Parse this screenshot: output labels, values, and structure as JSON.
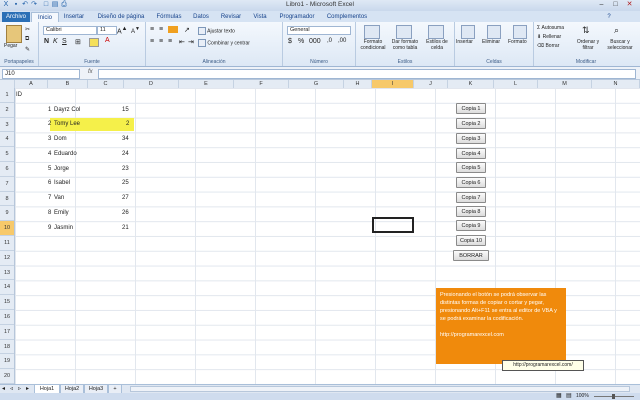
{
  "window": {
    "title": "Libro1 - Microsoft Excel"
  },
  "ribbon_tabs": [
    "Archivo",
    "Inicio",
    "Insertar",
    "Diseño de página",
    "Fórmulas",
    "Datos",
    "Revisar",
    "Vista",
    "Programador",
    "Complementos"
  ],
  "ribbon": {
    "paste_label": "Pegar",
    "font_name": "Calibri",
    "font_size": "11",
    "wrap_label": "Ajustar texto",
    "merge_label": "Combinar y centrar",
    "number_format": "General",
    "cond_format_label": "Formato condicional",
    "table_format_label": "Dar formato como tabla",
    "cell_styles_label": "Estilos de celda",
    "insert_label": "Insertar",
    "delete_label": "Eliminar",
    "format_label": "Formato",
    "autosum_label": "Autosuma",
    "fill_label": "Rellenar",
    "clear_label": "Borrar",
    "sort_label": "Ordenar y filtrar",
    "find_label": "Buscar y seleccionar",
    "groups": [
      "Portapapeles",
      "Fuente",
      "Alineación",
      "Número",
      "Estilos",
      "Celdas",
      "Modificar"
    ]
  },
  "formula_bar": {
    "name_box": "J10",
    "fx": "fx",
    "formula": ""
  },
  "columns": [
    "A",
    "B",
    "C",
    "D",
    "E",
    "F",
    "G",
    "H",
    "I",
    "J",
    "K",
    "L",
    "M",
    "N"
  ],
  "active_column": "J",
  "rows": [
    "1",
    "2",
    "3",
    "4",
    "5",
    "6",
    "7",
    "8",
    "9",
    "10",
    "11",
    "12",
    "13",
    "14",
    "15",
    "16",
    "17",
    "18",
    "19",
    "20"
  ],
  "active_row": "10",
  "cell_a1": "ID",
  "people": [
    {
      "id": "1",
      "name": "Dayrz Col",
      "value": "15"
    },
    {
      "id": "2",
      "name": "Tomy Lee",
      "value": "2"
    },
    {
      "id": "3",
      "name": "Dom",
      "value": "34"
    },
    {
      "id": "4",
      "name": "Eduardo",
      "value": "24"
    },
    {
      "id": "5",
      "name": "Jorge",
      "value": "23"
    },
    {
      "id": "6",
      "name": "Isabel",
      "value": "25"
    },
    {
      "id": "7",
      "name": "Van",
      "value": "27"
    },
    {
      "id": "8",
      "name": "Emily",
      "value": "26"
    },
    {
      "id": "9",
      "name": "Jasmin",
      "value": "21"
    }
  ],
  "copy_buttons": [
    "Copia 1",
    "Copia 2",
    "Copia 3",
    "Copia 4",
    "Copia 5",
    "Copia 6",
    "Copia 7",
    "Copia 8",
    "Copia 9",
    "Copia 10"
  ],
  "delete_button": "BORRAR",
  "note": {
    "text": "Presionando el botón se podrá observar las distintas formas de copiar o cortar y pegar, presionando Alt+F11 se entra al editor de VBA y se podrá examinar la codificación.",
    "url": "http://programarexcel.com"
  },
  "tooltip": "http://programarexcel.com/",
  "sheets": [
    "Hoja1",
    "Hoja2",
    "Hoja3"
  ],
  "active_sheet": "Hoja1",
  "status": {
    "zoom": "100%"
  },
  "colors": {
    "highlight": "#f5f04a",
    "note_bg": "#f08a0c",
    "active_header": "#f7c96a"
  }
}
